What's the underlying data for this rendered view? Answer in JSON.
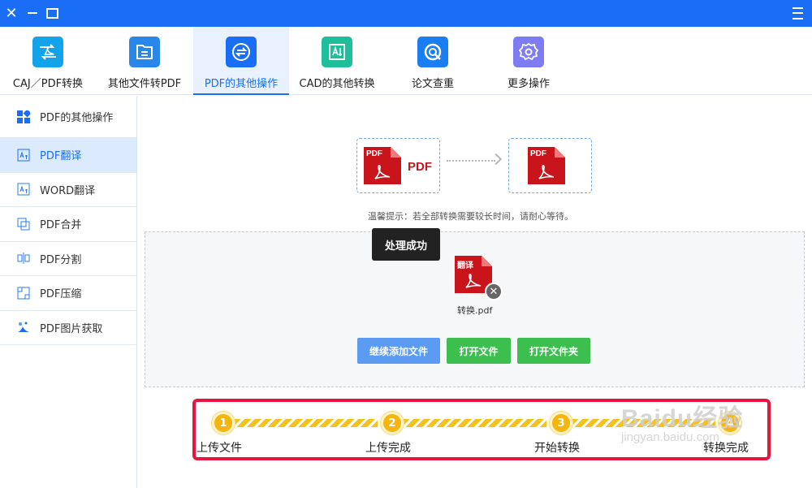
{
  "window": {
    "controls": [
      "close-icon",
      "minimize-icon",
      "maximize-icon",
      "menu-icon"
    ]
  },
  "toolbar": {
    "tabs": [
      {
        "label": "CAJ／PDF转换",
        "icon": "caj-pdf-convert-icon",
        "color": "#12a3ea"
      },
      {
        "label": "其他文件转PDF",
        "icon": "file-to-pdf-icon",
        "color": "#2a87ea"
      },
      {
        "label": "PDF的其他操作",
        "icon": "swap-icon",
        "color": "#1a6ef5"
      },
      {
        "label": "CAD的其他转换",
        "icon": "cad-icon",
        "color": "#1fbf9c"
      },
      {
        "label": "论文查重",
        "icon": "check-icon",
        "color": "#1a7ef0"
      },
      {
        "label": "更多操作",
        "icon": "gear-icon",
        "color": "#7d7cf2"
      }
    ],
    "active_index": 2
  },
  "sidebar": {
    "items": [
      {
        "label": "PDF的其他操作",
        "icon": "grid-icon"
      },
      {
        "label": "PDF翻译",
        "icon": "translate-icon"
      },
      {
        "label": "WORD翻译",
        "icon": "translate-icon"
      },
      {
        "label": "PDF合并",
        "icon": "merge-icon"
      },
      {
        "label": "PDF分割",
        "icon": "split-icon"
      },
      {
        "label": "PDF压缩",
        "icon": "compress-icon"
      },
      {
        "label": "PDF图片获取",
        "icon": "image-extract-icon"
      }
    ],
    "active_index": 1
  },
  "main": {
    "source_doc_tag": "PDF",
    "source_word": "PDF",
    "target_doc_tag": "",
    "tip": "温馨提示：若全部转换需要较长时间，请耐心等待。",
    "toast": "处理成功",
    "file": {
      "tag": "翻译",
      "name": "转换.pdf"
    },
    "buttons": {
      "continue_add": "继续添加文件",
      "open_file": "打开文件",
      "open_folder": "打开文件夹"
    }
  },
  "progress": {
    "steps": [
      {
        "num": "1",
        "label": "上传文件"
      },
      {
        "num": "2",
        "label": "上传完成"
      },
      {
        "num": "3",
        "label": "开始转换"
      },
      {
        "num": "4",
        "label": "转换完成"
      }
    ],
    "accent": "#f4b50f",
    "frame_color": "#e8153e"
  },
  "watermark": {
    "brand": "Baidu经验",
    "url": "jingyan.baidu.com"
  }
}
